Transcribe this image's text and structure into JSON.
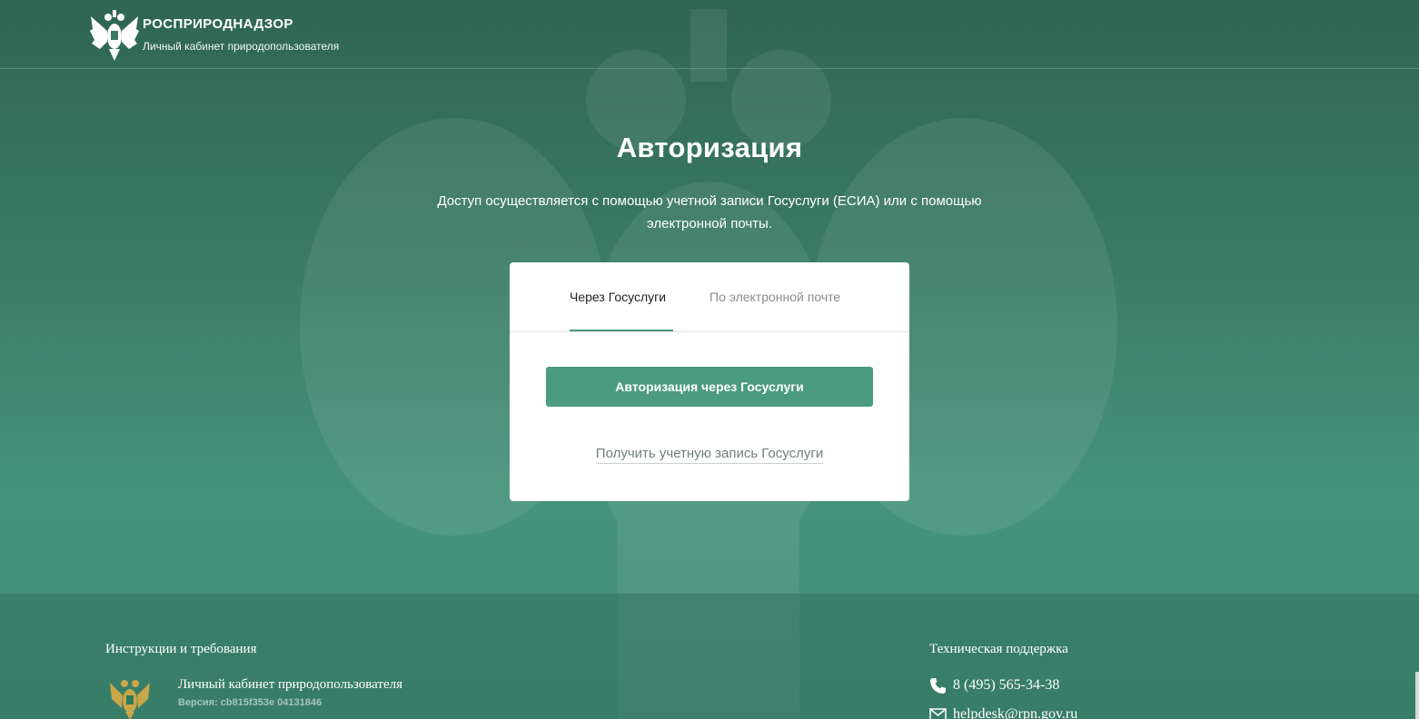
{
  "header": {
    "brand_title": "РОСПРИРОДНАДЗОР",
    "brand_subtitle": "Личный кабинет природопользователя",
    "logo_icon": "eagle-emblem-icon"
  },
  "main": {
    "title": "Авторизация",
    "description": "Доступ осуществляется с помощью учетной записи Госуслуги (ЕСИА) или с помощью электронной почты.",
    "tabs": [
      {
        "label": "Через Госуслуги",
        "active": true
      },
      {
        "label": "По электронной почте",
        "active": false
      }
    ],
    "login_button": "Авторизация через Госуслуги",
    "register_link": "Получить учетную запись Госуслуги"
  },
  "footer": {
    "instructions": "Инструкции и требования",
    "cabinet_name": "Личный кабинет природопользователя",
    "version": "Версия: cb815f353e 04131846",
    "support_title": "Техническая поддержка",
    "phone": "8 (495) 565-34-38",
    "email": "helpdesk@rpn.gov.ru"
  },
  "colors": {
    "background": "#3d7f6a",
    "accent": "#4a9b80",
    "card": "#ffffff"
  }
}
